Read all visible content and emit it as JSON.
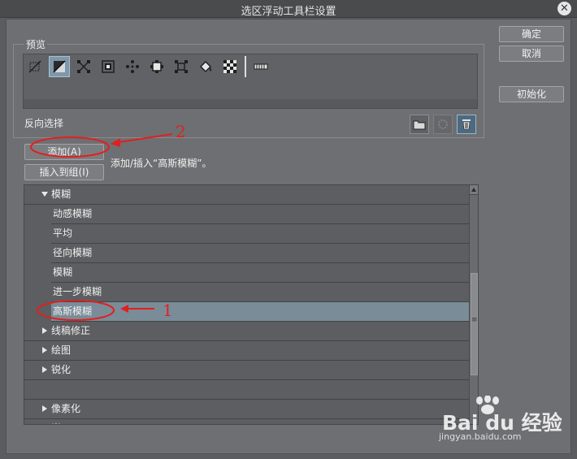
{
  "window": {
    "title": "选区浮动工具栏设置",
    "close_glyph": "✕"
  },
  "preview": {
    "label": "预览",
    "icons": [
      "deselect-icon",
      "invert-selection-icon",
      "transform-icon",
      "scale-icon",
      "dots-icon",
      "expand-icon",
      "shrink-icon",
      "fill-icon",
      "checker-icon",
      "trim-icon"
    ],
    "selected_icon": "invert-selection-icon",
    "current_item_label": "反向选择"
  },
  "buttons": {
    "ok": "确定",
    "cancel": "取消",
    "init": "初始化",
    "add": "添加(A)",
    "insert": "插入到组(I)"
  },
  "hint": "添加/插入“高斯模糊”。",
  "list": {
    "rows": [
      {
        "label": "模糊",
        "type": "category",
        "expanded": true
      },
      {
        "label": "动感模糊",
        "type": "child"
      },
      {
        "label": "平均",
        "type": "child"
      },
      {
        "label": "径向模糊",
        "type": "child"
      },
      {
        "label": "模糊",
        "type": "child"
      },
      {
        "label": "进一步模糊",
        "type": "child"
      },
      {
        "label": "高斯模糊",
        "type": "child",
        "selected": true
      },
      {
        "label": "线稿修正",
        "type": "category",
        "expanded": false
      },
      {
        "label": "绘图",
        "type": "category",
        "expanded": false
      },
      {
        "label": "锐化",
        "type": "category",
        "expanded": false
      },
      {
        "label": "",
        "type": "category",
        "expanded": null
      },
      {
        "label": "像素化",
        "type": "category",
        "expanded": false
      },
      {
        "label": "光",
        "type": "category",
        "expanded": false
      }
    ]
  },
  "annotations": {
    "one": "1",
    "two": "2",
    "color": "#e02020"
  },
  "watermark": {
    "brand": "Bai du 经验",
    "url": "jingyan.baidu.com"
  }
}
